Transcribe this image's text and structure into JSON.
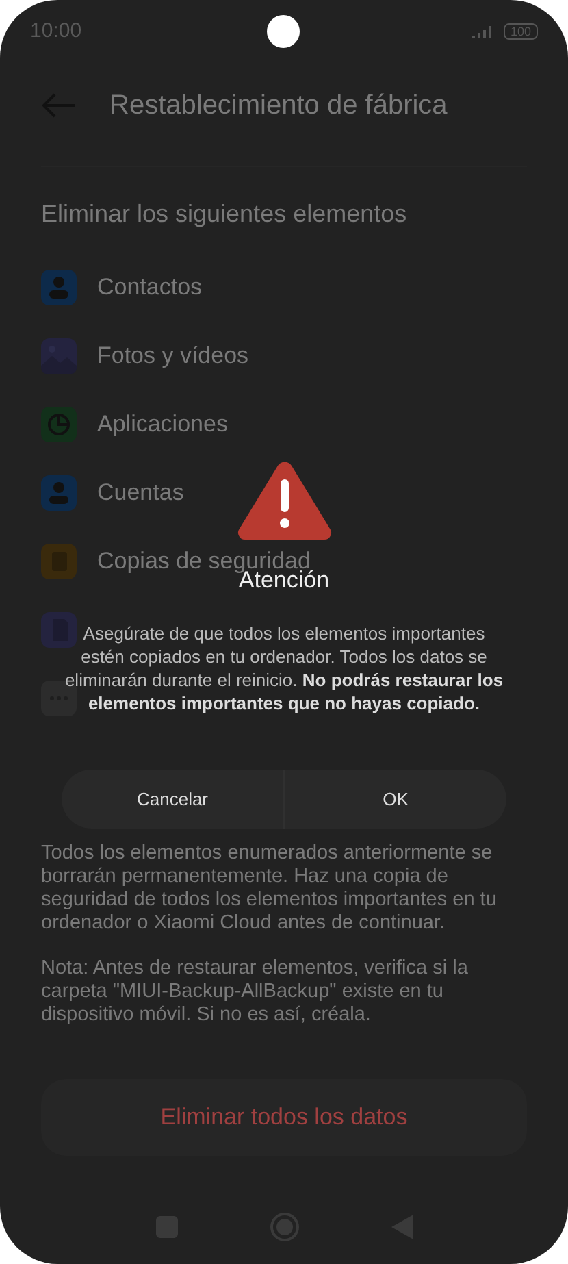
{
  "status_bar": {
    "time": "10:00",
    "battery": "100"
  },
  "header": {
    "title": "Restablecimiento de fábrica"
  },
  "section": {
    "title": "Eliminar los siguientes elementos",
    "items": [
      {
        "kind": "contact",
        "label": "Contactos"
      },
      {
        "kind": "photo",
        "label": "Fotos y vídeos"
      },
      {
        "kind": "apps",
        "label": "Aplicaciones"
      },
      {
        "kind": "contact",
        "label": "Cuentas"
      },
      {
        "kind": "backup",
        "label": "Copias de seguridad"
      },
      {
        "kind": "sd"
      },
      {
        "kind": "other"
      }
    ]
  },
  "info": "Todos los elementos enumerados anteriormente se borrarán permanentemente. Haz una copia de seguridad de todos los elementos importantes en tu ordenador o Xiaomi Cloud antes de continuar.",
  "note": "Nota: Antes de restaurar elementos, verifica si la carpeta \"MIUI-Backup-AllBackup\" existe en tu dispositivo móvil. Si no es así, créala.",
  "primary_button": "Eliminar todos los datos",
  "dialog": {
    "title": "Atención",
    "message": "Asegúrate de que todos los elementos importantes estén copiados en tu ordenador. Todos los datos se eliminarán durante el reinicio. **No podrás restaurar los elementos importantes que no hayas copiado.**",
    "buttons": [
      "Cancelar",
      "OK"
    ]
  }
}
